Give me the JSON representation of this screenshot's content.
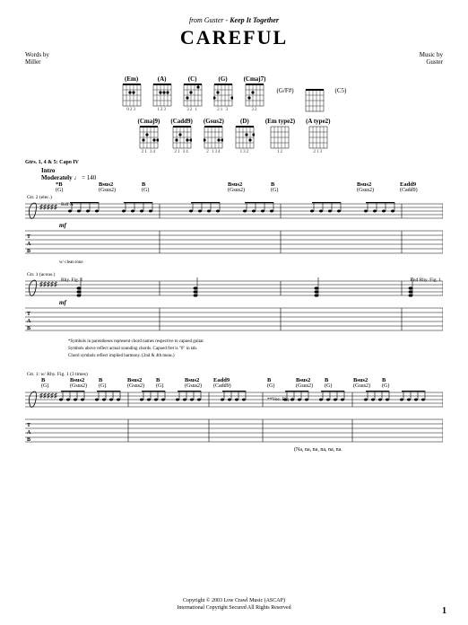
{
  "header": {
    "from_prefix": "from Guster - ",
    "album": "Keep It Together",
    "title": "CAREFUL",
    "words_by_label": "Words by",
    "words_by": "Miller",
    "music_by_label": "Music by",
    "music_by": "Guster"
  },
  "chord_diagrams": {
    "row1": [
      {
        "name": "(Em)",
        "fing": "023"
      },
      {
        "name": "(A)",
        "fing": "123"
      },
      {
        "name": "(C)",
        "fing": "32 1"
      },
      {
        "name": "(G)",
        "fing": "21  3"
      },
      {
        "name": "(Cmaj7)",
        "fing": "32"
      }
    ],
    "row1_extras": [
      {
        "label": "(G/F#)"
      },
      {
        "label": "(C5)"
      }
    ],
    "row2": [
      {
        "name": "(Cmaj9)",
        "fing": "21 34"
      },
      {
        "name": "(Cadd9)",
        "fing": "21 34"
      },
      {
        "name": "(Gsus2)",
        "fing": "2 134"
      },
      {
        "name": "(D)",
        "fing": "132"
      },
      {
        "name": "(Em type2)",
        "fing": "12"
      },
      {
        "name": "(A type2)",
        "fing": "213"
      }
    ]
  },
  "performance": {
    "capo": "Gtrs. 1, 4 & 5: Capo IV",
    "section": "Intro",
    "tempo_label": "Moderately",
    "tempo_bpm": "♩ = 140"
  },
  "systems": {
    "s1_chords_top": [
      "*B",
      "Bsus2",
      "B",
      "",
      "Bsus2",
      "B",
      "",
      "Bsus2",
      "Eadd9"
    ],
    "s1_chords_paren": [
      "(G)",
      "(Gsus2)",
      "(G)",
      "",
      "(Gsus2)",
      "(G)",
      "",
      "(Gsus2)",
      "(Cadd9)"
    ],
    "s1_gtr": "Gtr. 2 (elec.)",
    "s1_riff": "Riff A",
    "s1_dyn": "mf",
    "s1_wtone": "w/ clean tone",
    "s2_gtr": "Gtr. 1 (acous.)",
    "s2_rhy": "Rhy. Fig. 1",
    "s2_rhy_end": "End Rhy. Fig. 1",
    "s2_dyn": "mf",
    "footnote1": "*Symbols in parentheses represent chord names respective to capoed guitar.",
    "footnote2": "Symbols above reflect actual sounding chords. Capoed fret is \"0\" in tab.",
    "footnote3": "Chord symbols reflect implied harmony. (2nd & 4th meas.)",
    "s3_gtr": "Gtr. 1: w/ Rhy. Fig. 1 (3 times)",
    "s3_chords_top": [
      "B",
      "Bsus2",
      "B",
      "Bsus2",
      "B",
      "Bsus2",
      "Eadd9",
      "",
      "B",
      "Bsus2",
      "B",
      "Bsus2",
      "B"
    ],
    "s3_chords_paren": [
      "(G)",
      "(Gsus2)",
      "(G)",
      "(Gsus2)",
      "(G)",
      "(Gsus2)",
      "(Cadd9)",
      "",
      "(G)",
      "(Gsus2)",
      "(G)",
      "(Gsus2)",
      "(G)"
    ],
    "s3_voc": "**Voc. Fig. 1",
    "s3_lyrics": "(Na,     na,      na,      na,     na,     na."
  },
  "footer": {
    "c1": "Copyright © 2003 Low Crawl Music (ASCAP)",
    "c2": "International Copyright Secured   All Rights Reserved",
    "page": "1"
  }
}
